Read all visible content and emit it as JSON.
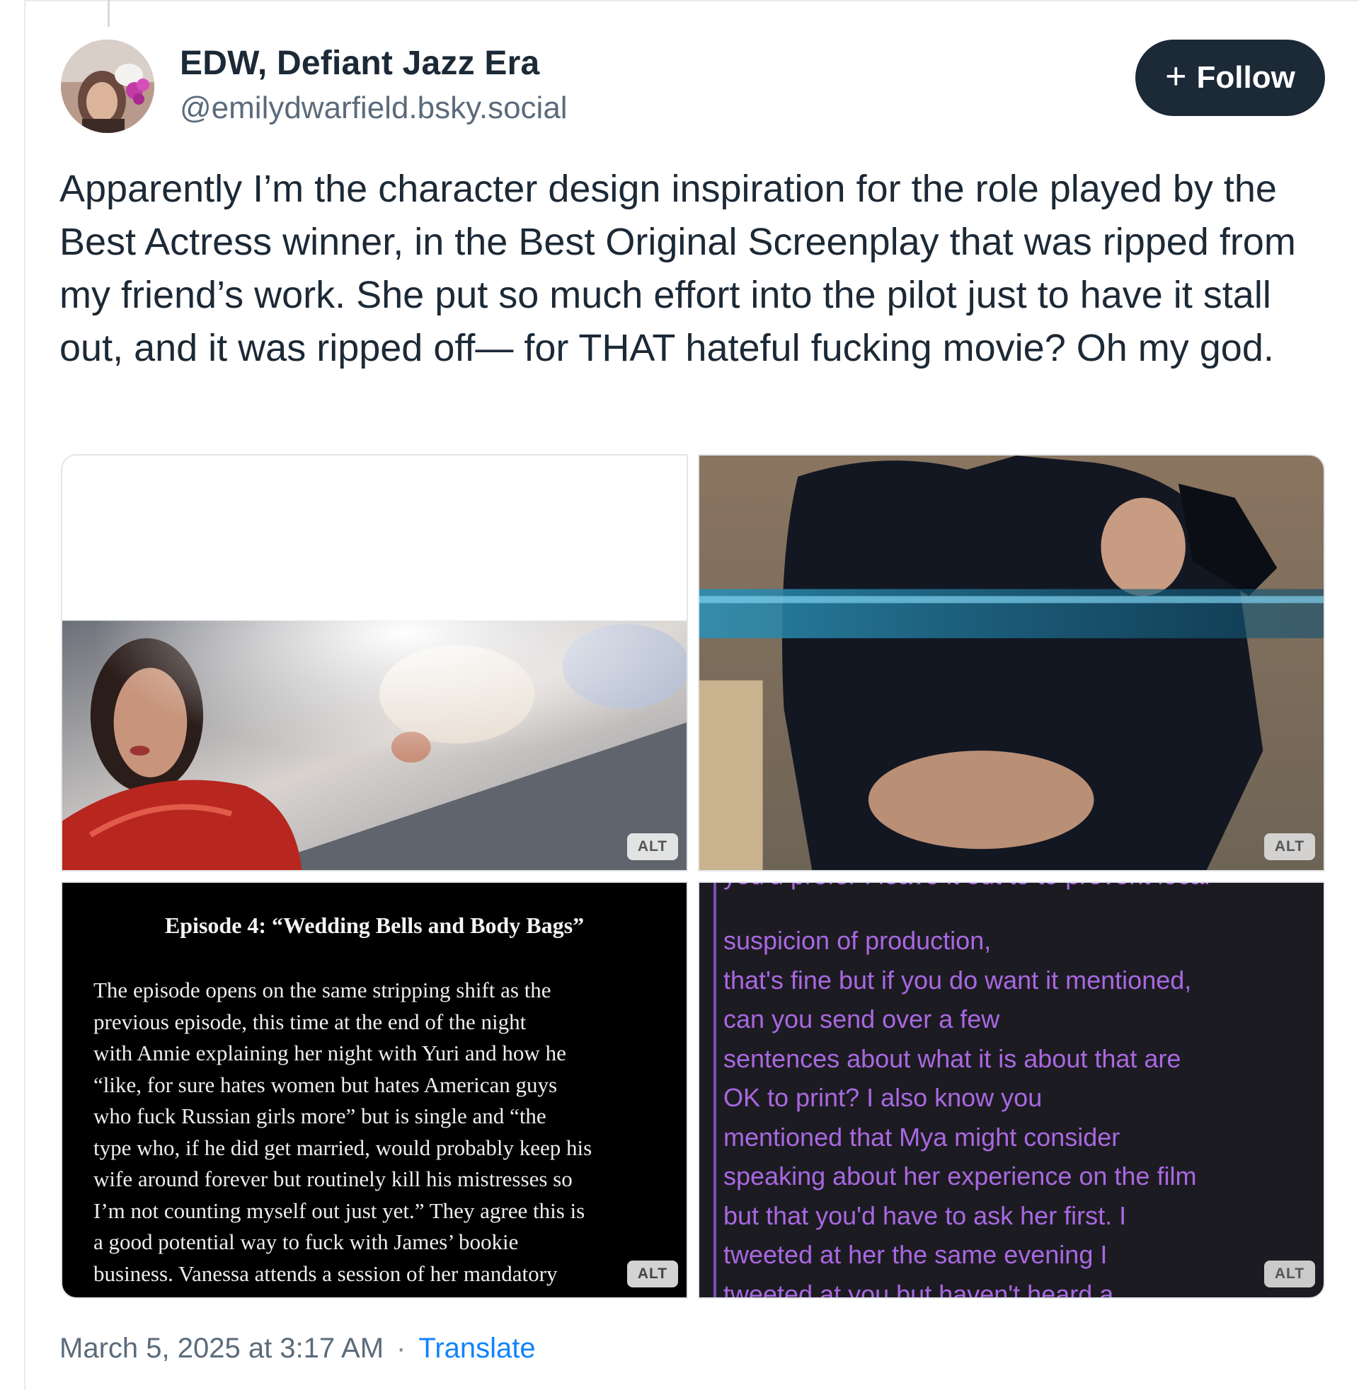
{
  "author": {
    "display_name": "EDW, Defiant Jazz Era",
    "handle": "@emilydwarfield.bsky.social"
  },
  "follow_button": {
    "icon": "plus-icon",
    "label": "Follow"
  },
  "post": {
    "text": "Apparently I’m the character design inspiration for the role played by the Best Actress winner, in the Best Original Screenplay that was ripped from my friend’s work. She put so much effort into the pilot just to have it stall out, and it was ripped off— for THAT hateful fucking movie? Oh my god.",
    "images": [
      {
        "alt_badge": "ALT"
      },
      {
        "alt_badge": "ALT"
      },
      {
        "alt_badge": "ALT",
        "title": "Episode 4: “Wedding Bells and Body Bags”",
        "lines": [
          "The episode opens on the same stripping shift as the",
          "previous episode, this time at the end  of the night",
          "with Annie explaining her night with Yuri and how he",
          "“like, for sure hates  women but hates American guys",
          "who fuck Russian girls more” but is single and “the",
          "type  who, if he did get married, would probably keep his",
          "wife around forever but routinely kill his  mistresses so",
          "I’m not counting myself out just yet.” They agree this is",
          "a good potential way to  fuck with James’ bookie",
          "business. Vanessa attends a session of her mandatory"
        ]
      },
      {
        "alt_badge": "ALT",
        "cut_top": "you'd prefer I leave it out to to prevent local",
        "lines": [
          "suspicion of production,",
          "that's fine but if you do want it mentioned,",
          "can you send over a few",
          "sentences about what it is about that are",
          "OK to print? I also know you",
          "mentioned that Mya might consider",
          "speaking about her experience on the film",
          "but that you'd have to ask her first. I",
          "tweeted at her the same evening I"
        ],
        "cut_bottom": "tweeted at you but haven't heard a"
      }
    ],
    "timestamp": "March 5, 2025 at 3:17 AM",
    "separator": "·",
    "translate_label": "Translate"
  }
}
